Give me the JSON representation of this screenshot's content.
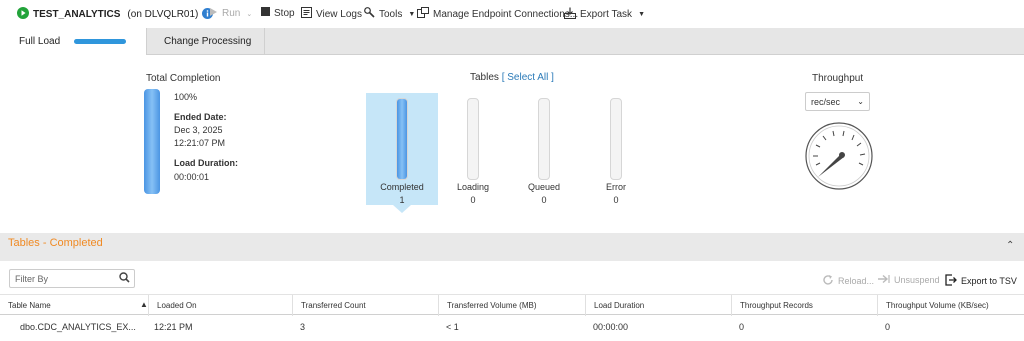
{
  "toolbar": {
    "task_name": "TEST_ANALYTICS",
    "server": "(on DLVQLR01)",
    "run_label": "Run",
    "stop_label": "Stop",
    "view_logs_label": "View Logs",
    "tools_label": "Tools",
    "manage_label": "Manage Endpoint Connections...",
    "export_task_label": "Export Task"
  },
  "tabs": [
    {
      "label": "Full Load",
      "active": true,
      "progress": 1.0
    },
    {
      "label": "Change Processing",
      "active": false
    }
  ],
  "summary": {
    "title": "Total Completion",
    "percent": "100%",
    "ended_label": "Ended Date:",
    "ended_date": "Dec 3, 2025",
    "ended_time": "12:21:07 PM",
    "duration_label": "Load Duration:",
    "duration": "00:00:01",
    "fill": 1.0
  },
  "tables": {
    "title": "Tables",
    "select_all": "[ Select All ]",
    "states": [
      {
        "label": "Completed",
        "count": "1",
        "fill": 1.0
      },
      {
        "label": "Loading",
        "count": "0",
        "fill": 0
      },
      {
        "label": "Queued",
        "count": "0",
        "fill": 0
      },
      {
        "label": "Error",
        "count": "0",
        "fill": 0
      }
    ]
  },
  "throughput": {
    "title": "Throughput",
    "unit": "rec/sec"
  },
  "panel": {
    "title": "Tables - Completed",
    "filter_placeholder": "Filter By",
    "reload_label": "Reload...",
    "unsuspend_label": "Unsuspend",
    "export_label": "Export to TSV"
  },
  "table": {
    "columns": [
      "Table Name",
      "Loaded On",
      "Transferred Count",
      "Transferred Volume (MB)",
      "Load Duration",
      "Throughput Records",
      "Throughput Volume (KB/sec)"
    ],
    "rows": [
      [
        "dbo.CDC_ANALYTICS_EX...",
        "12:21 PM",
        "3",
        "< 1",
        "00:00:00",
        "0",
        "0"
      ]
    ]
  },
  "colors": {
    "accent": "#2f96dc",
    "panel_title": "#f08a24",
    "link": "#2a7ab8",
    "status_running": "#22a33a"
  }
}
